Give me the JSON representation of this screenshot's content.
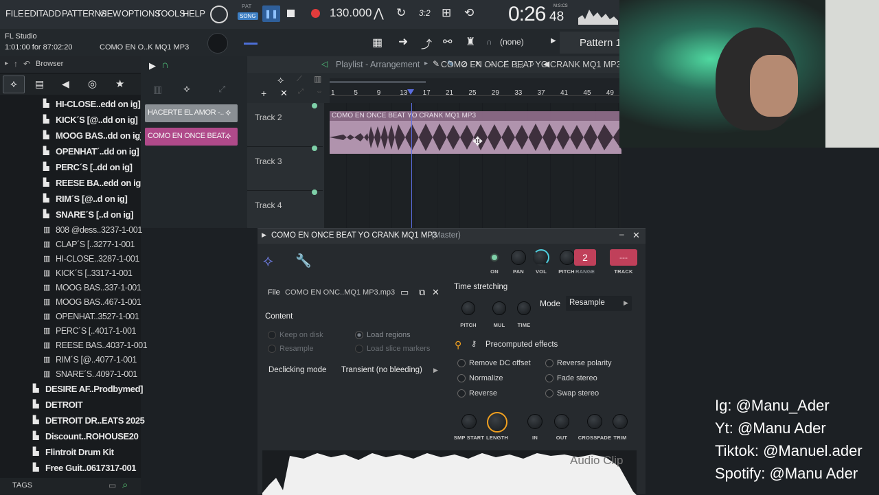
{
  "menu": [
    "FILE",
    "EDIT",
    "ADD",
    "PATTERNS",
    "VIEW",
    "OPTIONS",
    "TOOLS",
    "HELP"
  ],
  "transport": {
    "pat_label": "PAT",
    "song_label": "SONG",
    "tempo": "130.000",
    "time_main": "0:26",
    "time_sub": "48",
    "time_mode": "M:S:CS",
    "snap_display": "3:2"
  },
  "app": {
    "name": "FL Studio",
    "position": "1:01:00 for 87:02:20",
    "hint": "COMO EN O..K MQ1 MP3"
  },
  "toolbar2": {
    "none_label": "(none)",
    "pattern": "Pattern 1"
  },
  "browser": {
    "title": "Browser",
    "items": [
      {
        "label": "HI-CLOSE..edd on ig]",
        "type": "pack"
      },
      {
        "label": "KICK´S [@..dd on ig]",
        "type": "pack"
      },
      {
        "label": "MOOG BAS..dd on ig]",
        "type": "pack"
      },
      {
        "label": "OPENHAT´..dd on ig]",
        "type": "pack"
      },
      {
        "label": "PERC´S [..dd on ig]",
        "type": "pack"
      },
      {
        "label": "REESE BA..edd on ig]",
        "type": "pack"
      },
      {
        "label": "RIM´S [@..d on ig]",
        "type": "pack"
      },
      {
        "label": "SNARE´S [..d on ig]",
        "type": "pack"
      },
      {
        "label": "808 @dess..3237-1-001",
        "type": "file"
      },
      {
        "label": "CLAP´S [..3277-1-001",
        "type": "file"
      },
      {
        "label": "HI-CLOSE..3287-1-001",
        "type": "file"
      },
      {
        "label": "KICK´S [..3317-1-001",
        "type": "file"
      },
      {
        "label": "MOOG BAS..337-1-001",
        "type": "file"
      },
      {
        "label": "MOOG BAS..467-1-001",
        "type": "file"
      },
      {
        "label": "OPENHAT..3527-1-001",
        "type": "file"
      },
      {
        "label": "PERC´S [..4017-1-001",
        "type": "file"
      },
      {
        "label": "REESE BAS..4037-1-001",
        "type": "file"
      },
      {
        "label": "RIM´S [@..4077-1-001",
        "type": "file"
      },
      {
        "label": "SNARE´S..4097-1-001",
        "type": "file"
      },
      {
        "label": "DESIRE AF..Prodbymed]",
        "type": "folder"
      },
      {
        "label": "DETROIT",
        "type": "folder"
      },
      {
        "label": "DETROIT DR..EATS 2025",
        "type": "folder"
      },
      {
        "label": "Discount..ROHOUSE20",
        "type": "folder"
      },
      {
        "label": "Flintroit Drum Kit",
        "type": "folder"
      },
      {
        "label": "Free Guit..0617317-001",
        "type": "folder"
      }
    ],
    "tags": "TAGS"
  },
  "channels": [
    {
      "label": "HACERTE EL AMOR -.."
    },
    {
      "label": "COMO EN ONCE BEAT.."
    }
  ],
  "playlist": {
    "title": "Playlist - Arrangement",
    "clip_title": "COMO EN ONCE BEAT YO CRANK MQ1 MP3",
    "clip_label": "COMO EN ONCE BEAT YO CRANK MQ1 MP3",
    "ticks": [
      "1",
      "5",
      "9",
      "13",
      "17",
      "21",
      "25",
      "29",
      "33",
      "37",
      "41",
      "45",
      "49"
    ],
    "tracks": [
      "Track 2",
      "Track 3",
      "Track 4"
    ]
  },
  "clip": {
    "title": "COMO EN ONCE BEAT YO CRANK MQ1 MP3",
    "title_suffix": "(Master)",
    "knobs": {
      "on": "ON",
      "pan": "PAN",
      "vol": "VOL",
      "pitch": "PITCH",
      "range": "RANGE",
      "range_value": "2",
      "track": "TRACK",
      "track_value": "---"
    },
    "file_label": "File",
    "file_name": "COMO EN ONC..MQ1 MP3.mp3",
    "content_heading": "Content",
    "keep_on_disk": "Keep on disk",
    "resample": "Resample",
    "load_regions": "Load regions",
    "load_slice_markers": "Load slice markers",
    "declicking_label": "Declicking mode",
    "declicking_value": "Transient (no bleeding)",
    "time_stretching": "Time stretching",
    "ts_knobs": {
      "pitch": "PITCH",
      "mul": "MUL",
      "time": "TIME"
    },
    "mode_label": "Mode",
    "mode_value": "Resample",
    "precomputed": "Precomputed effects",
    "effects": {
      "remove_dc": "Remove DC offset",
      "normalize": "Normalize",
      "reverse": "Reverse",
      "reverse_polarity": "Reverse polarity",
      "fade_stereo": "Fade stereo",
      "swap_stereo": "Swap stereo"
    },
    "bottom_knobs": {
      "smp_start": "SMP START",
      "length": "LENGTH",
      "in": "IN",
      "out": "OUT",
      "crossfade": "CROSSFADE",
      "trim": "TRIM"
    },
    "watermark": "Audio Clip"
  },
  "social": {
    "ig": "Ig: @Manu_Ader",
    "yt": "Yt: @Manu Ader",
    "tiktok": "Tiktok: @Manuel.ader",
    "spotify": "Spotify: @Manu Ader"
  },
  "colors": {
    "accent": "#d16b86",
    "clip_bg": "#c9a8c8",
    "knob_orange": "#f0a020",
    "vol_cyan": "#4fd0e0",
    "channel_sel": "#b04a8a"
  }
}
